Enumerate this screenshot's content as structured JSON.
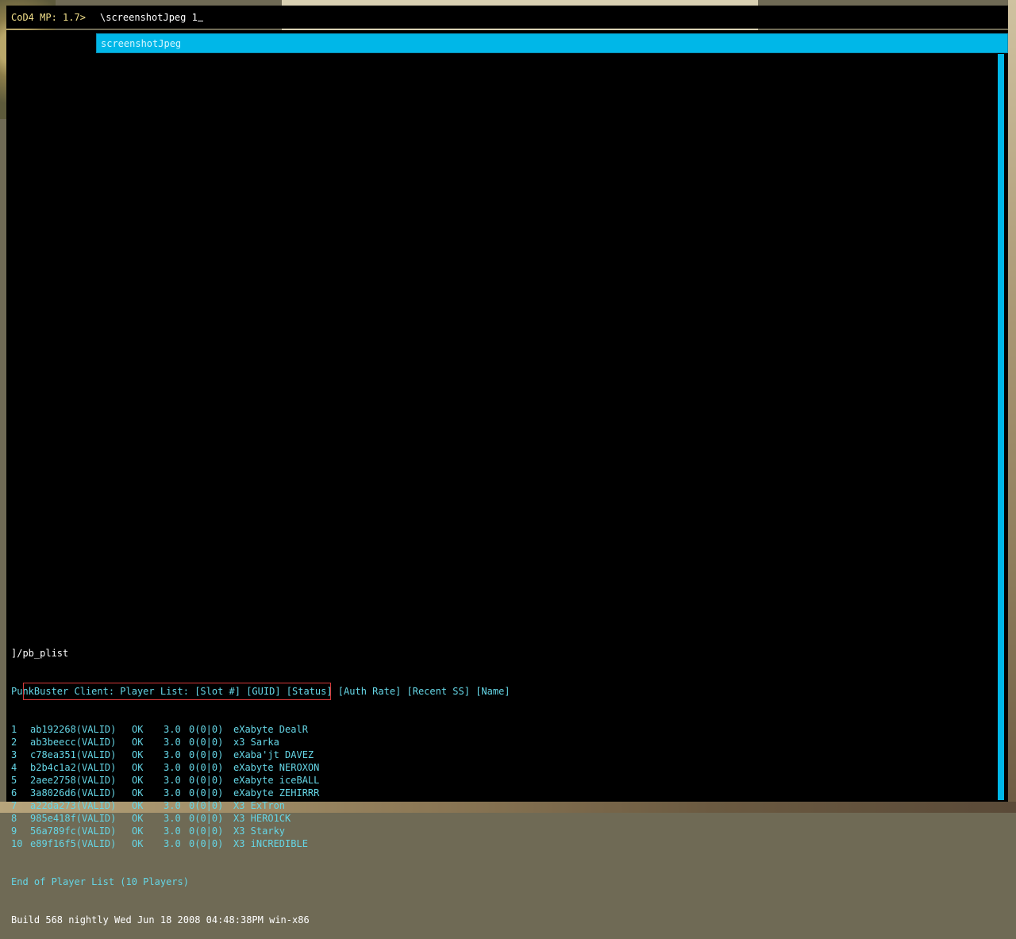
{
  "input": {
    "prompt": "CoD4 MP: 1.7>",
    "text": "\\screenshotJpeg 1"
  },
  "autocomplete": {
    "item": "screenshotJpeg"
  },
  "console": {
    "command": "]/pb_plist",
    "header": "PunkBuster Client: Player List: [Slot #] [GUID] [Status] [Auth Rate] [Recent SS] [Name]",
    "players": [
      {
        "slot": "1",
        "guid": "ab192268(VALID)",
        "status": "OK",
        "rate": "3.0",
        "ss": "0(0|0)",
        "name": "eXabyte DealR"
      },
      {
        "slot": "2",
        "guid": "ab3beecc(VALID)",
        "status": "OK",
        "rate": "3.0",
        "ss": "0(0|0)",
        "name": "x3 Sarka"
      },
      {
        "slot": "3",
        "guid": "c78ea351(VALID)",
        "status": "OK",
        "rate": "3.0",
        "ss": "0(0|0)",
        "name": "eXaba'jt DAVEZ"
      },
      {
        "slot": "4",
        "guid": "b2b4c1a2(VALID)",
        "status": "OK",
        "rate": "3.0",
        "ss": "0(0|0)",
        "name": "eXabyte NEROXON"
      },
      {
        "slot": "5",
        "guid": "2aee2758(VALID)",
        "status": "OK",
        "rate": "3.0",
        "ss": "0(0|0)",
        "name": "eXabyte iceBALL"
      },
      {
        "slot": "6",
        "guid": "3a8026d6(VALID)",
        "status": "OK",
        "rate": "3.0",
        "ss": "0(0|0)",
        "name": "eXabyte ZEHIRRR"
      },
      {
        "slot": "7",
        "guid": "a22da273(VALID)",
        "status": "OK",
        "rate": "3.0",
        "ss": "0(0|0)",
        "name": "X3 ExTron"
      },
      {
        "slot": "8",
        "guid": "985e418f(VALID)",
        "status": "OK",
        "rate": "3.0",
        "ss": "0(0|0)",
        "name": "X3 HERO1CK"
      },
      {
        "slot": "9",
        "guid": "56a789fc(VALID)",
        "status": "OK",
        "rate": "3.0",
        "ss": "0(0|0)",
        "name": "X3 Starky"
      },
      {
        "slot": "10",
        "guid": "e89f16f5(VALID)",
        "status": "OK",
        "rate": "3.0",
        "ss": "0(0|0)",
        "name": "X3 iNCREDIBLE"
      }
    ],
    "footer": "End of Player List (10 Players)",
    "build": "Build 568 nightly Wed Jun 18 2008 04:48:38PM win-x86"
  },
  "colors": {
    "accent": "#00b7e8",
    "text_cyan": "#65d6e6",
    "prompt_yellow": "#f2e08a",
    "highlight_red": "#d43a3a"
  }
}
